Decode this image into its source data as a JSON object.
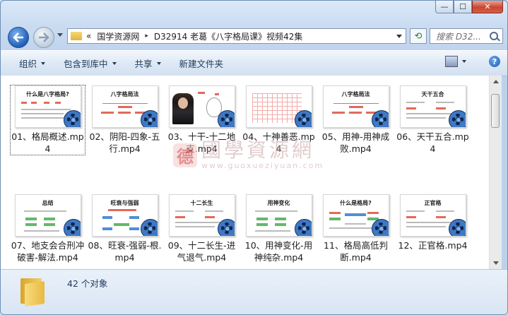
{
  "window": {
    "caption": {
      "minimize": "—",
      "maximize": "☐",
      "close": "✕"
    }
  },
  "address": {
    "chevron": "«",
    "segments": [
      "国学资源网",
      "D32914  老葛《八字格局课》视频42集"
    ],
    "separator": "▸"
  },
  "search": {
    "placeholder": "搜索 D32..."
  },
  "toolbar": {
    "organize": "组织",
    "include_library": "包含到库中",
    "share": "共享",
    "new_folder": "新建文件夹",
    "help": "?"
  },
  "watermark": {
    "logo_char": "德",
    "text": "國學資源網",
    "url": "www.guoxueziyuan.com"
  },
  "files": [
    {
      "name": "01、格局概述.mp4",
      "thumb_title": "什么是八字格局?",
      "style": "title"
    },
    {
      "name": "02、阴阳-四象-五行.mp4",
      "thumb_title": "八字格局法",
      "style": "red"
    },
    {
      "name": "03、十干-十二地支.mp4",
      "thumb_title": "",
      "style": "person"
    },
    {
      "name": "04、十神善恶.mp4",
      "thumb_title": "",
      "style": "grid"
    },
    {
      "name": "05、用神-用神成败.mp4",
      "thumb_title": "八字格局法",
      "style": "red"
    },
    {
      "name": "06、天干五合.mp4",
      "thumb_title": "天干五合",
      "style": "chart"
    },
    {
      "name": "07、地支会合刑冲破害-解法.mp4",
      "thumb_title": "总结",
      "style": "green"
    },
    {
      "name": "08、旺衰-强弱-根.mp4",
      "thumb_title": "旺衰与强弱",
      "style": "blue"
    },
    {
      "name": "09、十二长生-进气退气.mp4",
      "thumb_title": "十二长生",
      "style": "chart"
    },
    {
      "name": "10、用神变化-用神纯杂.mp4",
      "thumb_title": "用神变化",
      "style": "green"
    },
    {
      "name": "11、格局高低判断.mp4",
      "thumb_title": "什么是格局?",
      "style": "colorful"
    },
    {
      "name": "12、正官格.mp4",
      "thumb_title": "正官格",
      "style": "chart"
    }
  ],
  "status": {
    "count_text": "42 个对象"
  }
}
